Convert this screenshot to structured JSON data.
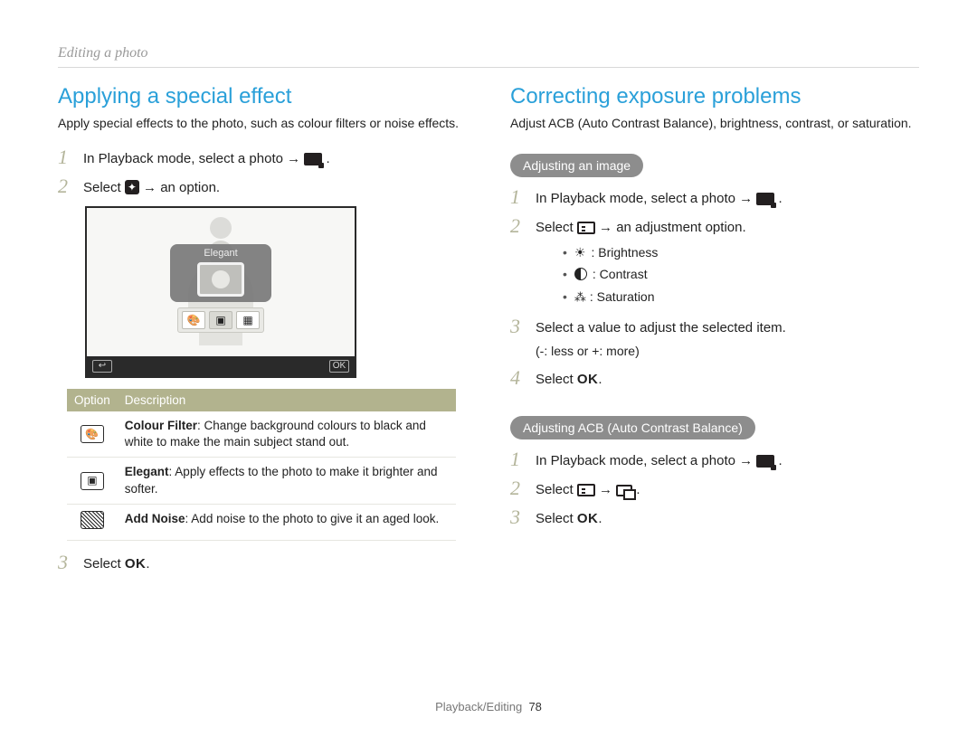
{
  "breadcrumb": "Editing a photo",
  "footer": {
    "section": "Playback/Editing",
    "page": "78"
  },
  "left": {
    "heading": "Applying a special effect",
    "intro": "Apply special effects to the photo, such as colour filters or noise effects.",
    "steps": [
      {
        "n": "1",
        "text_pre": "In Playback mode, select a photo → ",
        "icon": "edit-photo",
        "text_post": "."
      },
      {
        "n": "2",
        "text_pre": "Select ",
        "icon": "effect",
        "text_post": " → an option."
      },
      {
        "n": "3",
        "text_pre": "Select ",
        "ok": true,
        "text_post": "."
      }
    ],
    "preview": {
      "popup_label": "Elegant",
      "toolbar": [
        "palette",
        "elegant",
        "noise"
      ],
      "back_label": "↩",
      "ok_label": "OK"
    },
    "table": {
      "head": [
        "Option",
        "Description"
      ],
      "rows": [
        {
          "icon": "palette",
          "title": "Colour Filter",
          "desc": ": Change background colours to black and white to make the main subject stand out."
        },
        {
          "icon": "elegant",
          "title": "Elegant",
          "desc": ": Apply effects to the photo to make it brighter and softer."
        },
        {
          "icon": "noise",
          "title": "Add Noise",
          "desc": ": Add noise to the photo to give it an aged look."
        }
      ]
    }
  },
  "right": {
    "heading": "Correcting exposure problems",
    "intro": "Adjust ACB (Auto Contrast Balance), brightness, contrast, or saturation.",
    "sub1": {
      "pill": "Adjusting an image",
      "steps": [
        {
          "n": "1",
          "text_pre": "In Playback mode, select a photo → ",
          "icon": "edit-photo",
          "text_post": "."
        },
        {
          "n": "2",
          "text_pre": "Select ",
          "icon": "adjust",
          "text_post": " → an adjustment option."
        },
        {
          "n": "3",
          "text_pre": "Select a value to adjust the selected item.",
          "sub": "(-: less or +: more)"
        },
        {
          "n": "4",
          "text_pre": "Select ",
          "ok": true,
          "text_post": "."
        }
      ],
      "bullets": [
        {
          "glyph": "sun",
          "label": ": Brightness"
        },
        {
          "glyph": "contrast",
          "label": ": Contrast"
        },
        {
          "glyph": "drops",
          "label": ": Saturation"
        }
      ]
    },
    "sub2": {
      "pill": "Adjusting ACB (Auto Contrast Balance)",
      "steps": [
        {
          "n": "1",
          "text_pre": "In Playback mode, select a photo → ",
          "icon": "edit-photo",
          "text_post": "."
        },
        {
          "n": "2",
          "text_pre": "Select ",
          "icon": "adjust",
          "icon2": "acb",
          "text_mid": " → ",
          "text_post": "."
        },
        {
          "n": "3",
          "text_pre": "Select ",
          "ok": true,
          "text_post": "."
        }
      ]
    }
  }
}
